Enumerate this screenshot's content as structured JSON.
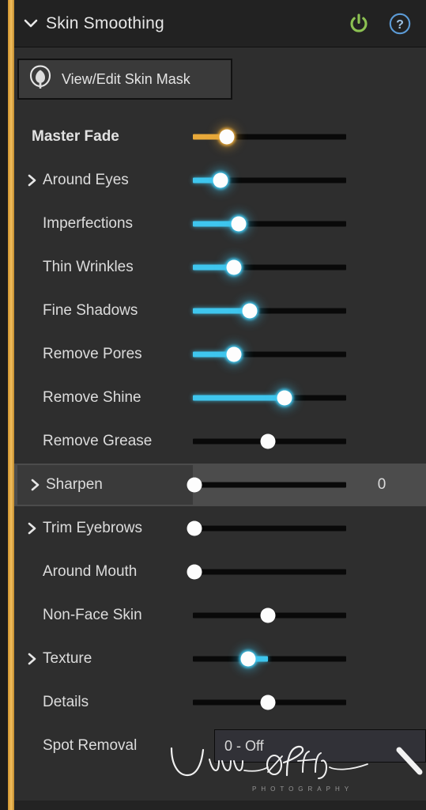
{
  "header": {
    "title": "Skin Smoothing",
    "collapse_icon": "chevron-down-icon",
    "power_icon": "power-toggle-icon",
    "help_icon": "help-circle-icon",
    "power_color": "#8cc152",
    "help_color": "#5c9bd6"
  },
  "accent_color": "#e9b14b",
  "mask_button": {
    "label": "View/Edit Skin Mask",
    "icon": "skin-mask-icon"
  },
  "colors": {
    "panel_bg": "#2e2e2e",
    "header_bg": "#222222",
    "highlight_row_bg": "#4c4c4c",
    "cyan": "#3fc6ee",
    "amber": "#e8a93a",
    "track": "#090909",
    "knob": "#fdfdfd"
  },
  "rows": [
    {
      "label": "Master Fade",
      "chevron": false,
      "bold": true,
      "indent": "master",
      "fill": "amber",
      "knob": "amber",
      "fill_style": "left",
      "position_pct": 22,
      "value": "",
      "highlight": false
    },
    {
      "label": "Around Eyes",
      "chevron": true,
      "bold": false,
      "indent": "group",
      "fill": "cyan",
      "knob": "cyan",
      "fill_style": "left",
      "position_pct": 18,
      "value": "",
      "highlight": false
    },
    {
      "label": "Imperfections",
      "chevron": false,
      "bold": false,
      "indent": "child",
      "fill": "cyan",
      "knob": "cyan",
      "fill_style": "left",
      "position_pct": 30,
      "value": "",
      "highlight": false
    },
    {
      "label": "Thin Wrinkles",
      "chevron": false,
      "bold": false,
      "indent": "child",
      "fill": "cyan",
      "knob": "cyan",
      "fill_style": "left",
      "position_pct": 27,
      "value": "",
      "highlight": false
    },
    {
      "label": "Fine Shadows",
      "chevron": false,
      "bold": false,
      "indent": "child",
      "fill": "cyan",
      "knob": "cyan",
      "fill_style": "left",
      "position_pct": 37,
      "value": "",
      "highlight": false
    },
    {
      "label": "Remove Pores",
      "chevron": false,
      "bold": false,
      "indent": "child",
      "fill": "cyan",
      "knob": "cyan",
      "fill_style": "left",
      "position_pct": 27,
      "value": "",
      "highlight": false
    },
    {
      "label": "Remove Shine",
      "chevron": false,
      "bold": false,
      "indent": "child",
      "fill": "cyan",
      "knob": "cyan",
      "fill_style": "left",
      "position_pct": 60,
      "value": "",
      "highlight": false
    },
    {
      "label": "Remove Grease",
      "chevron": false,
      "bold": false,
      "indent": "child",
      "fill": "none",
      "knob": "plain",
      "fill_style": "none",
      "position_pct": 49,
      "value": "",
      "highlight": false
    },
    {
      "label": "Sharpen",
      "chevron": true,
      "bold": false,
      "indent": "group",
      "fill": "none",
      "knob": "plain",
      "fill_style": "none",
      "position_pct": 1,
      "value": "0",
      "highlight": true
    },
    {
      "label": "Trim Eyebrows",
      "chevron": true,
      "bold": false,
      "indent": "group",
      "fill": "none",
      "knob": "plain",
      "fill_style": "none",
      "position_pct": 1,
      "value": "",
      "highlight": false
    },
    {
      "label": "Around Mouth",
      "chevron": false,
      "bold": false,
      "indent": "child",
      "fill": "none",
      "knob": "plain",
      "fill_style": "none",
      "position_pct": 1,
      "value": "",
      "highlight": false
    },
    {
      "label": "Non-Face Skin",
      "chevron": false,
      "bold": false,
      "indent": "child",
      "fill": "none",
      "knob": "plain",
      "fill_style": "none",
      "position_pct": 49,
      "value": "",
      "highlight": false
    },
    {
      "label": "Texture",
      "chevron": true,
      "bold": false,
      "indent": "group",
      "fill": "cyan",
      "knob": "cyan",
      "fill_style": "right",
      "position_pct": 36,
      "fill_extent_pct": 49,
      "value": "",
      "highlight": false
    },
    {
      "label": "Details",
      "chevron": false,
      "bold": false,
      "indent": "child",
      "fill": "none",
      "knob": "plain",
      "fill_style": "none",
      "position_pct": 49,
      "value": "",
      "highlight": false
    }
  ],
  "spot_removal": {
    "label": "Spot Removal",
    "selected_option": "0 - Off"
  },
  "watermark": {
    "name": "Jim Alps",
    "subtitle": "PHOTOGRAPHY"
  }
}
